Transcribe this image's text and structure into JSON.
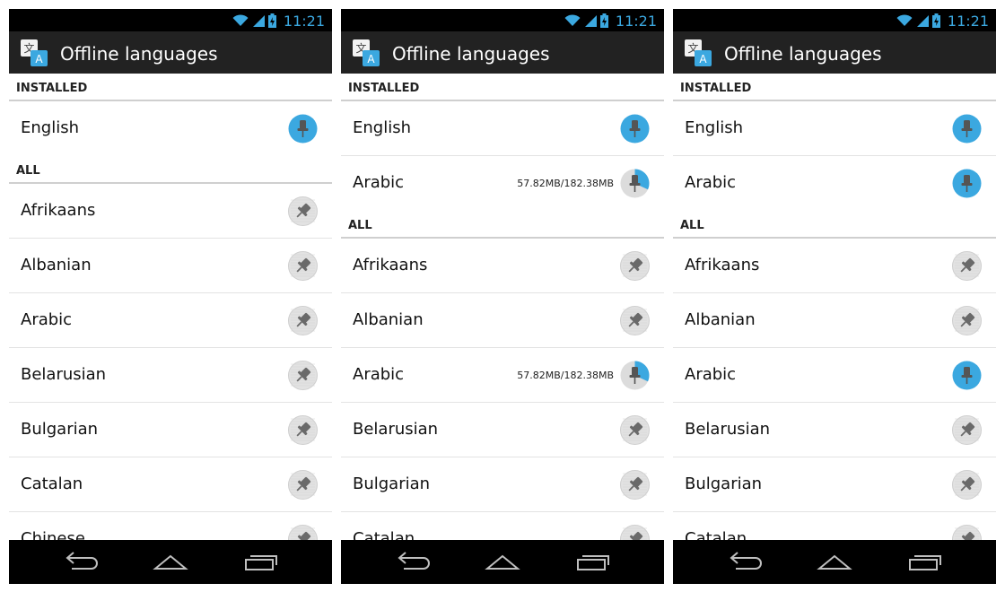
{
  "status_bar": {
    "time": "11:21"
  },
  "action_bar": {
    "title": "Offline languages"
  },
  "colors": {
    "accent": "#3ba8e0",
    "action_bar": "#222222",
    "status_bar": "#000000"
  },
  "screens": [
    {
      "sections": [
        {
          "header": "INSTALLED",
          "items": [
            {
              "label": "English",
              "pin": "installed",
              "size": ""
            }
          ]
        },
        {
          "header": "ALL",
          "items": [
            {
              "label": "Afrikaans",
              "pin": "available",
              "size": ""
            },
            {
              "label": "Albanian",
              "pin": "available",
              "size": ""
            },
            {
              "label": "Arabic",
              "pin": "available",
              "size": ""
            },
            {
              "label": "Belarusian",
              "pin": "available",
              "size": ""
            },
            {
              "label": "Bulgarian",
              "pin": "available",
              "size": ""
            },
            {
              "label": "Catalan",
              "pin": "available",
              "size": ""
            },
            {
              "label": "Chinese",
              "pin": "available",
              "size": ""
            }
          ]
        }
      ]
    },
    {
      "sections": [
        {
          "header": "INSTALLED",
          "items": [
            {
              "label": "English",
              "pin": "installed",
              "size": ""
            },
            {
              "label": "Arabic",
              "pin": "downloading",
              "size": "57.82MB/182.38MB",
              "progress": 0.32
            }
          ]
        },
        {
          "header": "ALL",
          "items": [
            {
              "label": "Afrikaans",
              "pin": "available",
              "size": ""
            },
            {
              "label": "Albanian",
              "pin": "available",
              "size": ""
            },
            {
              "label": "Arabic",
              "pin": "downloading",
              "size": "57.82MB/182.38MB",
              "progress": 0.32
            },
            {
              "label": "Belarusian",
              "pin": "available",
              "size": ""
            },
            {
              "label": "Bulgarian",
              "pin": "available",
              "size": ""
            },
            {
              "label": "Catalan",
              "pin": "available",
              "size": ""
            }
          ]
        }
      ]
    },
    {
      "sections": [
        {
          "header": "INSTALLED",
          "items": [
            {
              "label": "English",
              "pin": "installed",
              "size": ""
            },
            {
              "label": "Arabic",
              "pin": "installed",
              "size": ""
            }
          ]
        },
        {
          "header": "ALL",
          "items": [
            {
              "label": "Afrikaans",
              "pin": "available",
              "size": ""
            },
            {
              "label": "Albanian",
              "pin": "available",
              "size": ""
            },
            {
              "label": "Arabic",
              "pin": "installed",
              "size": ""
            },
            {
              "label": "Belarusian",
              "pin": "available",
              "size": ""
            },
            {
              "label": "Bulgarian",
              "pin": "available",
              "size": ""
            },
            {
              "label": "Catalan",
              "pin": "available",
              "size": ""
            }
          ]
        }
      ]
    }
  ],
  "nav": {
    "icons": [
      "back-icon",
      "home-icon",
      "recents-icon"
    ]
  }
}
